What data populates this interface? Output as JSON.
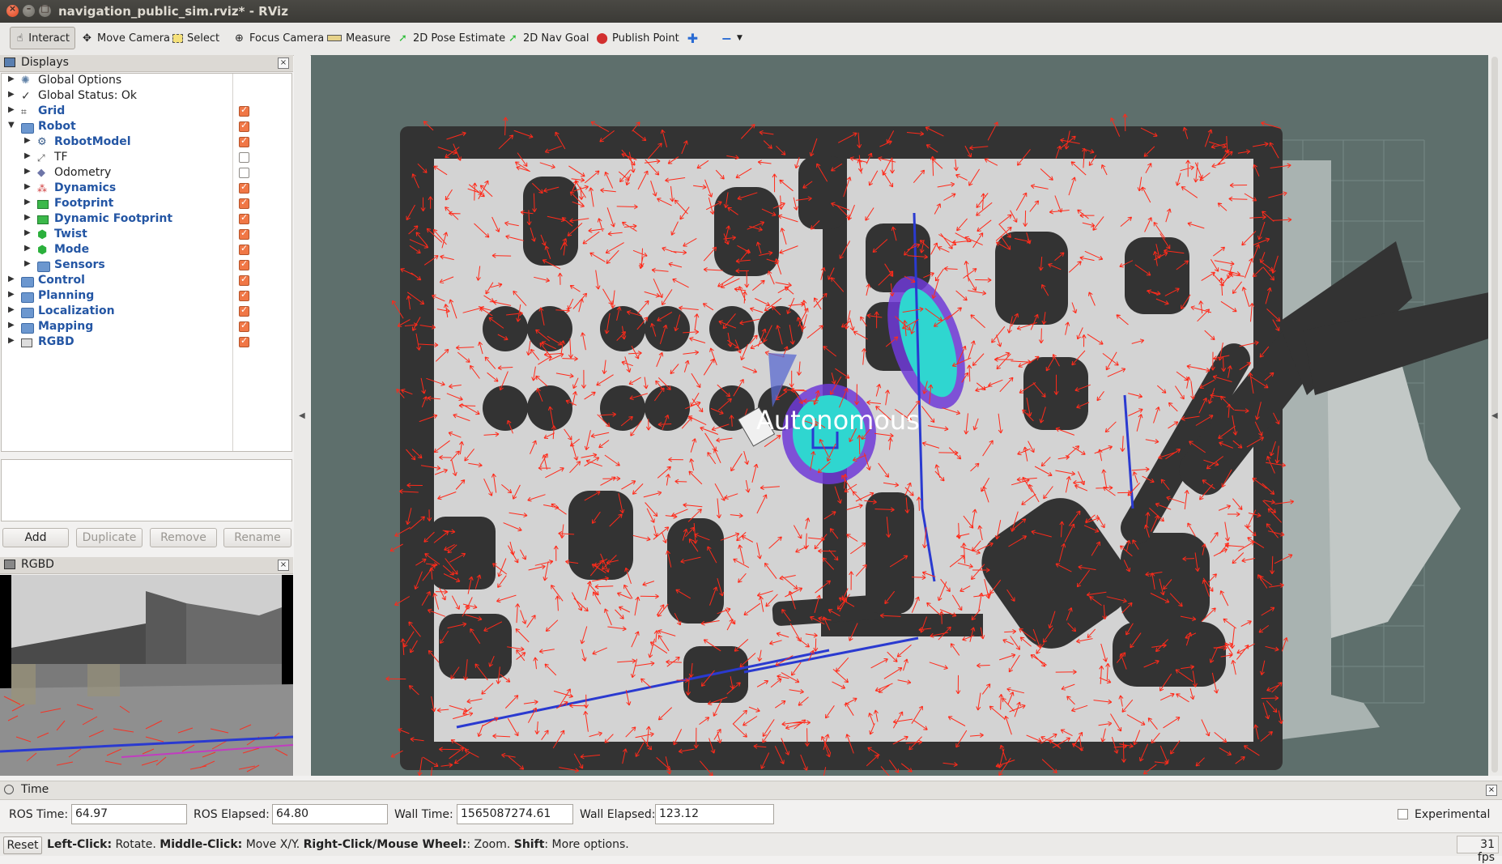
{
  "window": {
    "title": "navigation_public_sim.rviz* - RViz"
  },
  "toolbar": {
    "interact": "Interact",
    "move_camera": "Move Camera",
    "select": "Select",
    "focus_camera": "Focus Camera",
    "measure": "Measure",
    "pose_estimate": "2D Pose Estimate",
    "nav_goal": "2D Nav Goal",
    "publish_point": "Publish Point"
  },
  "displays": {
    "title": "Displays",
    "items": [
      {
        "label": "Global Options",
        "level": 0,
        "icon": "gear-icon",
        "bold": false,
        "checkbox": null
      },
      {
        "label": "Global Status: Ok",
        "level": 0,
        "icon": "check-icon",
        "bold": false,
        "checkbox": null
      },
      {
        "label": "Grid",
        "level": 0,
        "icon": "grid-icon",
        "bold": true,
        "checkbox": true
      },
      {
        "label": "Robot",
        "level": 0,
        "icon": "folder-icon",
        "bold": true,
        "checkbox": true
      },
      {
        "label": "RobotModel",
        "level": 1,
        "icon": "robot-model-icon",
        "bold": true,
        "checkbox": true
      },
      {
        "label": "TF",
        "level": 1,
        "icon": "tf-icon",
        "bold": false,
        "checkbox": false
      },
      {
        "label": "Odometry",
        "level": 1,
        "icon": "odometry-icon",
        "bold": false,
        "checkbox": false
      },
      {
        "label": "Dynamics",
        "level": 1,
        "icon": "dynamics-icon",
        "bold": true,
        "checkbox": true
      },
      {
        "label": "Footprint",
        "level": 1,
        "icon": "polygon-icon",
        "bold": true,
        "checkbox": true
      },
      {
        "label": "Dynamic Footprint",
        "level": 1,
        "icon": "polygon-icon",
        "bold": true,
        "checkbox": true
      },
      {
        "label": "Twist",
        "level": 1,
        "icon": "marker-icon",
        "bold": true,
        "checkbox": true
      },
      {
        "label": "Mode",
        "level": 1,
        "icon": "marker-icon",
        "bold": true,
        "checkbox": true
      },
      {
        "label": "Sensors",
        "level": 1,
        "icon": "folder-icon",
        "bold": true,
        "checkbox": true
      },
      {
        "label": "Control",
        "level": 0,
        "icon": "folder-icon",
        "bold": true,
        "checkbox": true
      },
      {
        "label": "Planning",
        "level": 0,
        "icon": "folder-icon",
        "bold": true,
        "checkbox": true
      },
      {
        "label": "Localization",
        "level": 0,
        "icon": "folder-icon",
        "bold": true,
        "checkbox": true
      },
      {
        "label": "Mapping",
        "level": 0,
        "icon": "folder-icon",
        "bold": true,
        "checkbox": true
      },
      {
        "label": "RGBD",
        "level": 0,
        "icon": "rgbd-icon",
        "bold": true,
        "checkbox": true
      }
    ],
    "buttons": {
      "add": "Add",
      "duplicate": "Duplicate",
      "remove": "Remove",
      "rename": "Rename"
    }
  },
  "rgbd_panel": {
    "title": "RGBD"
  },
  "view": {
    "overlay_text": "Autonomous"
  },
  "time": {
    "title": "Time",
    "ros_time_label": "ROS Time:",
    "ros_time": "64.97",
    "ros_elapsed_label": "ROS Elapsed:",
    "ros_elapsed": "64.80",
    "wall_time_label": "Wall Time:",
    "wall_time": "1565087274.61",
    "wall_elapsed_label": "Wall Elapsed:",
    "wall_elapsed": "123.12",
    "experimental": "Experimental"
  },
  "status": {
    "reset": "Reset",
    "h1": "Left-Click:",
    "t1": " Rotate. ",
    "h2": "Middle-Click:",
    "t2": " Move X/Y. ",
    "h3": "Right-Click/Mouse Wheel:",
    "t3": ": Zoom. ",
    "h4": "Shift",
    "t4": ": More options.",
    "fps": "31 fps"
  },
  "colors": {
    "map_free": "#d0d0d0",
    "map_wall": "#3a3a3a",
    "background": "#5e6f6c",
    "particles": "#ff2a1a",
    "costmap_cyan": "#2fd6d0",
    "costmap_purple": "#6f3ad6",
    "checkbox_on": "#f07746",
    "link_blue": "#2456a4"
  }
}
